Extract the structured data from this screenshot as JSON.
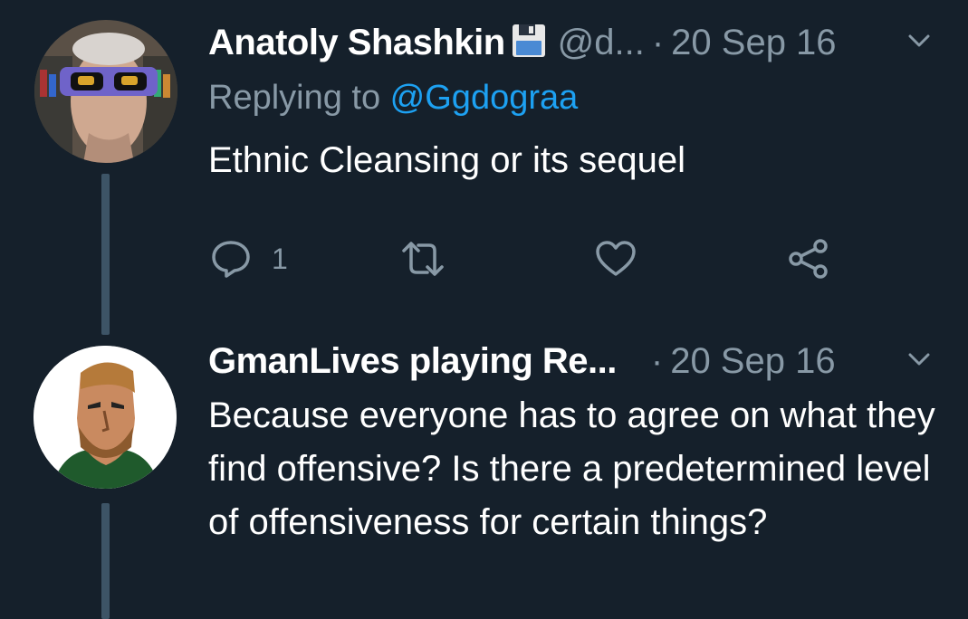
{
  "tweets": [
    {
      "name": "Anatoly Shashkin",
      "badge_icon": "floppy-disk-icon",
      "handle": "@d...",
      "separator": "·",
      "date": "20 Sep 16",
      "reply_prefix": "Replying to ",
      "reply_mention": "@Ggdograa",
      "text": "Ethnic Cleansing or its sequel",
      "reply_count": "1"
    },
    {
      "name": "GmanLives playing Re...",
      "separator": "·",
      "date": "20 Sep 16",
      "text": "Because everyone has to agree on what they find offensive? Is there a predetermined level of offensiveness for certain things?"
    }
  ],
  "colors": {
    "background": "#15202b",
    "secondary_text": "#8899a6",
    "link": "#1da1f2",
    "thread_line": "#3d5466"
  }
}
